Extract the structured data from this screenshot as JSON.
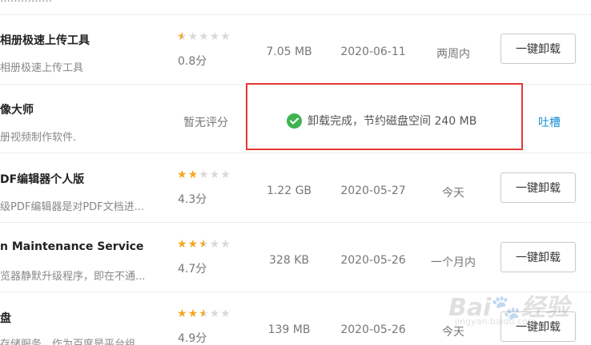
{
  "top_fragment": "……………",
  "uninstall_label": "一键卸载",
  "rows": [
    {
      "name": "相册极速上传工具",
      "desc": "相册极速上传工具",
      "rating": 0.8,
      "score": "0.8分",
      "size": "7.05 MB",
      "date": "2020-06-11",
      "frequency": "两周内"
    },
    {
      "name": "像大师",
      "desc": "册视频制作软件.",
      "score_text": "暂无评分",
      "notice": "卸载完成，节约磁盘空间 240 MB",
      "feedback": "吐槽"
    },
    {
      "name": "DF编辑器个人版",
      "desc": "级PDF编辑器是对PDF文档进...",
      "rating": 4.3,
      "score": "4.3分",
      "size": "1.22 GB",
      "date": "2020-05-27",
      "frequency": "今天"
    },
    {
      "name": "n Maintenance Service",
      "desc": "览器静默升级程序，即在不通...",
      "rating": 4.7,
      "score": "4.7分",
      "size": "328 KB",
      "date": "2020-05-26",
      "frequency": "一个月内"
    },
    {
      "name": "盘",
      "desc": "存储服务，作为百度是平台组",
      "rating": 4.9,
      "score": "4.9分",
      "size": "139 MB",
      "date": "2020-05-26",
      "frequency": "今天"
    }
  ],
  "star_colors": {
    "filled": "#f5a623",
    "empty": "#d9d9d9"
  },
  "highlight_color": "#e53935",
  "success_color": "#3fb34f",
  "link_color": "#1a8fd6",
  "watermark": {
    "logo": "Bai滴经验",
    "url": "jingyan.baidu.com"
  }
}
